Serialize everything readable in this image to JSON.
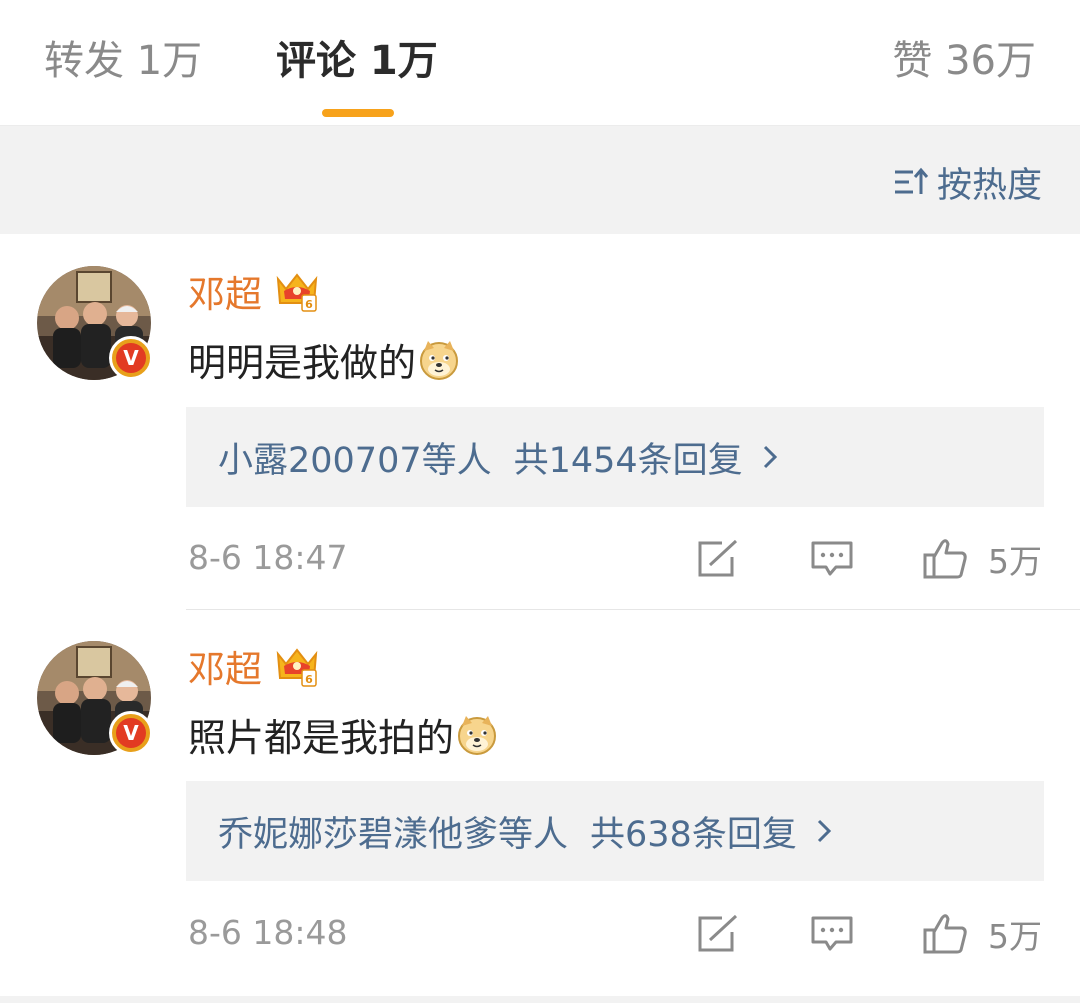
{
  "tabs": {
    "repost": "转发 1万",
    "comment": "评论 1万",
    "like": "赞 36万"
  },
  "sort": {
    "label": "按热度",
    "icon": "sort-icon"
  },
  "colors": {
    "accent": "#f7a21b",
    "username": "#e5782c",
    "link": "#4d6c8f",
    "background": "#f2f2f2"
  },
  "comments": [
    {
      "author": "邓超",
      "text": "明明是我做的",
      "emoji": "doge-emoji",
      "reply_users": "小露200707等人",
      "reply_count": "共1454条回复",
      "time": "8-6 18:47",
      "likes": "5万"
    },
    {
      "author": "邓超",
      "text": "照片都是我拍的",
      "emoji": "doge-emoji",
      "reply_users": "乔妮娜莎碧漾他爹等人",
      "reply_count": "共638条回复",
      "time": "8-6 18:48",
      "likes": "5万"
    }
  ]
}
